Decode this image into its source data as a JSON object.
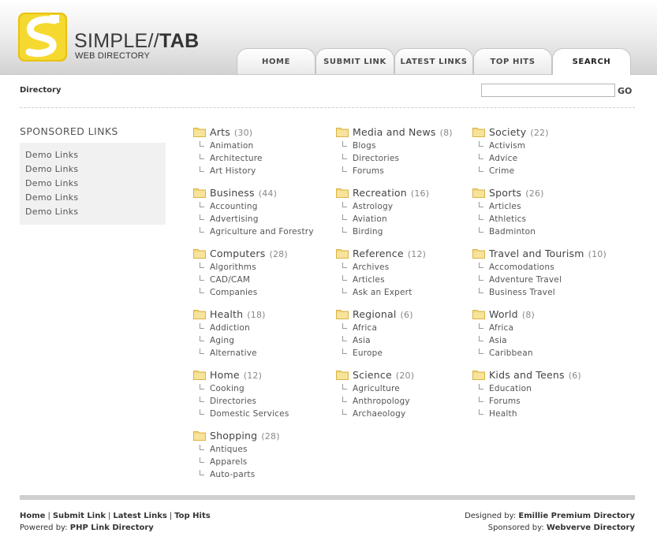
{
  "brand": {
    "title_light": "SIMPLE//",
    "title_bold": "TAB",
    "subtitle": "WEB DIRECTORY",
    "accent_color": "#f2d21f"
  },
  "nav": {
    "tabs": [
      {
        "label": "HOME",
        "active": false
      },
      {
        "label": "SUBMIT LINK",
        "active": false
      },
      {
        "label": "LATEST LINKS",
        "active": false
      },
      {
        "label": "TOP HITS",
        "active": false
      },
      {
        "label": "SEARCH",
        "active": true
      }
    ]
  },
  "breadcrumb": "Directory",
  "search": {
    "value": "",
    "placeholder": "",
    "button_label": "GO"
  },
  "sponsored": {
    "title": "SPONSORED LINKS",
    "links": [
      "Demo Links",
      "Demo Links",
      "Demo Links",
      "Demo Links",
      "Demo Links"
    ]
  },
  "categories": [
    {
      "name": "Arts",
      "count": "(30)",
      "subs": [
        "Animation",
        "Architecture",
        "Art History"
      ]
    },
    {
      "name": "Media and News",
      "count": "(8)",
      "subs": [
        "Blogs",
        "Directories",
        "Forums"
      ]
    },
    {
      "name": "Society",
      "count": "(22)",
      "subs": [
        "Activism",
        "Advice",
        "Crime"
      ]
    },
    {
      "name": "Business",
      "count": "(44)",
      "subs": [
        "Accounting",
        "Advertising",
        "Agriculture and Forestry"
      ]
    },
    {
      "name": "Recreation",
      "count": "(16)",
      "subs": [
        "Astrology",
        "Aviation",
        "Birding"
      ]
    },
    {
      "name": "Sports",
      "count": "(26)",
      "subs": [
        "Articles",
        "Athletics",
        "Badminton"
      ]
    },
    {
      "name": "Computers",
      "count": "(28)",
      "subs": [
        "Algorithms",
        "CAD/CAM",
        "Companies"
      ]
    },
    {
      "name": "Reference",
      "count": "(12)",
      "subs": [
        "Archives",
        "Articles",
        "Ask an Expert"
      ]
    },
    {
      "name": "Travel and Tourism",
      "count": "(10)",
      "subs": [
        "Accomodations",
        "Adventure Travel",
        "Business Travel"
      ]
    },
    {
      "name": "Health",
      "count": "(18)",
      "subs": [
        "Addiction",
        "Aging",
        "Alternative"
      ]
    },
    {
      "name": "Regional",
      "count": "(6)",
      "subs": [
        "Africa",
        "Asia",
        "Europe"
      ]
    },
    {
      "name": "World",
      "count": "(8)",
      "subs": [
        "Africa",
        "Asia",
        "Caribbean"
      ]
    },
    {
      "name": "Home",
      "count": "(12)",
      "subs": [
        "Cooking",
        "Directories",
        "Domestic Services"
      ]
    },
    {
      "name": "Science",
      "count": "(20)",
      "subs": [
        "Agriculture",
        "Anthropology",
        "Archaeology"
      ]
    },
    {
      "name": "Kids and Teens",
      "count": "(6)",
      "subs": [
        "Education",
        "Forums",
        "Health"
      ]
    },
    {
      "name": "Shopping",
      "count": "(28)",
      "subs": [
        "Antiques",
        "Apparels",
        "Auto-parts"
      ]
    }
  ],
  "footer": {
    "links": [
      "Home",
      "Submit Link",
      "Latest Links",
      "Top Hits"
    ],
    "powered_prefix": "Powered by:",
    "powered_link": "PHP Link Directory",
    "designed_prefix": "Designed by:",
    "designed_link": "Emillie Premium Directory",
    "sponsored_prefix": "Sponsored by:",
    "sponsored_link": "Webverve Directory"
  }
}
